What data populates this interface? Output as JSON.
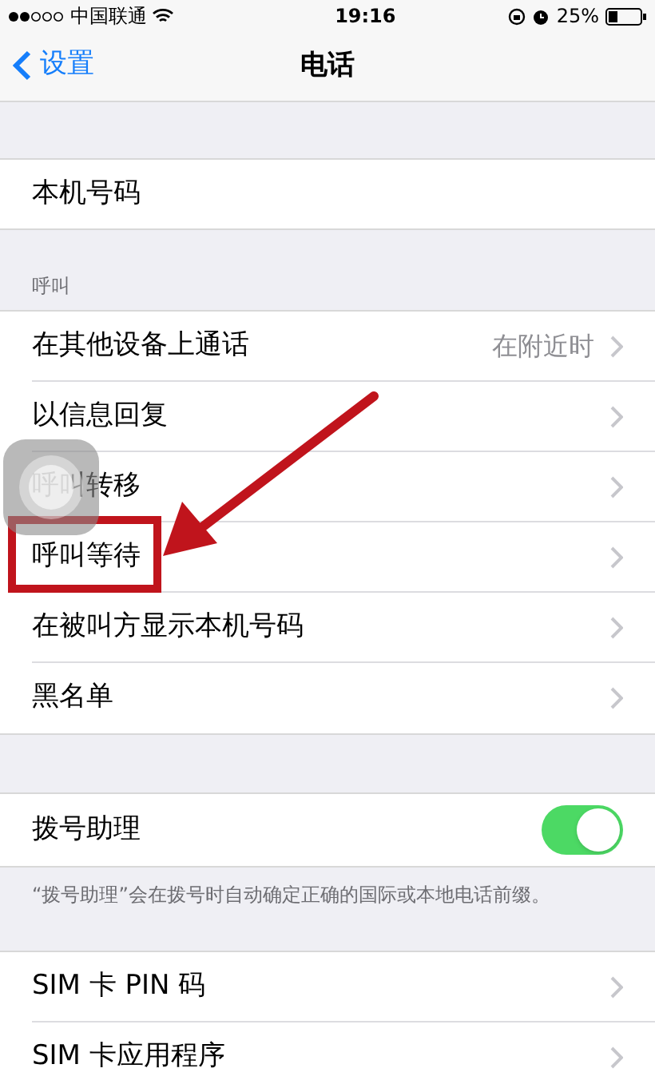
{
  "status_bar": {
    "carrier": "中国联通",
    "time": "19:16",
    "battery": "25%"
  },
  "nav": {
    "back": "设置",
    "title": "电话"
  },
  "groups": [
    {
      "rows": [
        {
          "kind": "plain",
          "label": "本机号码"
        }
      ]
    },
    {
      "header": "呼叫",
      "rows": [
        {
          "kind": "link",
          "label": "在其他设备上通话",
          "value": "在附近时"
        },
        {
          "kind": "link",
          "label": "以信息回复"
        },
        {
          "kind": "link",
          "label": "呼叫转移"
        },
        {
          "kind": "link",
          "label": "呼叫等待",
          "highlighted": true
        },
        {
          "kind": "link",
          "label": "在被叫方显示本机号码"
        },
        {
          "kind": "link",
          "label": "黑名单"
        }
      ]
    },
    {
      "rows": [
        {
          "kind": "toggle",
          "label": "拨号助理",
          "on": true
        }
      ],
      "footer": "“拨号助理”会在拨号时自动确定正确的国际或本地电话前缀。"
    },
    {
      "rows": [
        {
          "kind": "link",
          "label": "SIM 卡 PIN 码"
        },
        {
          "kind": "link",
          "label": "SIM 卡应用程序"
        }
      ]
    }
  ]
}
